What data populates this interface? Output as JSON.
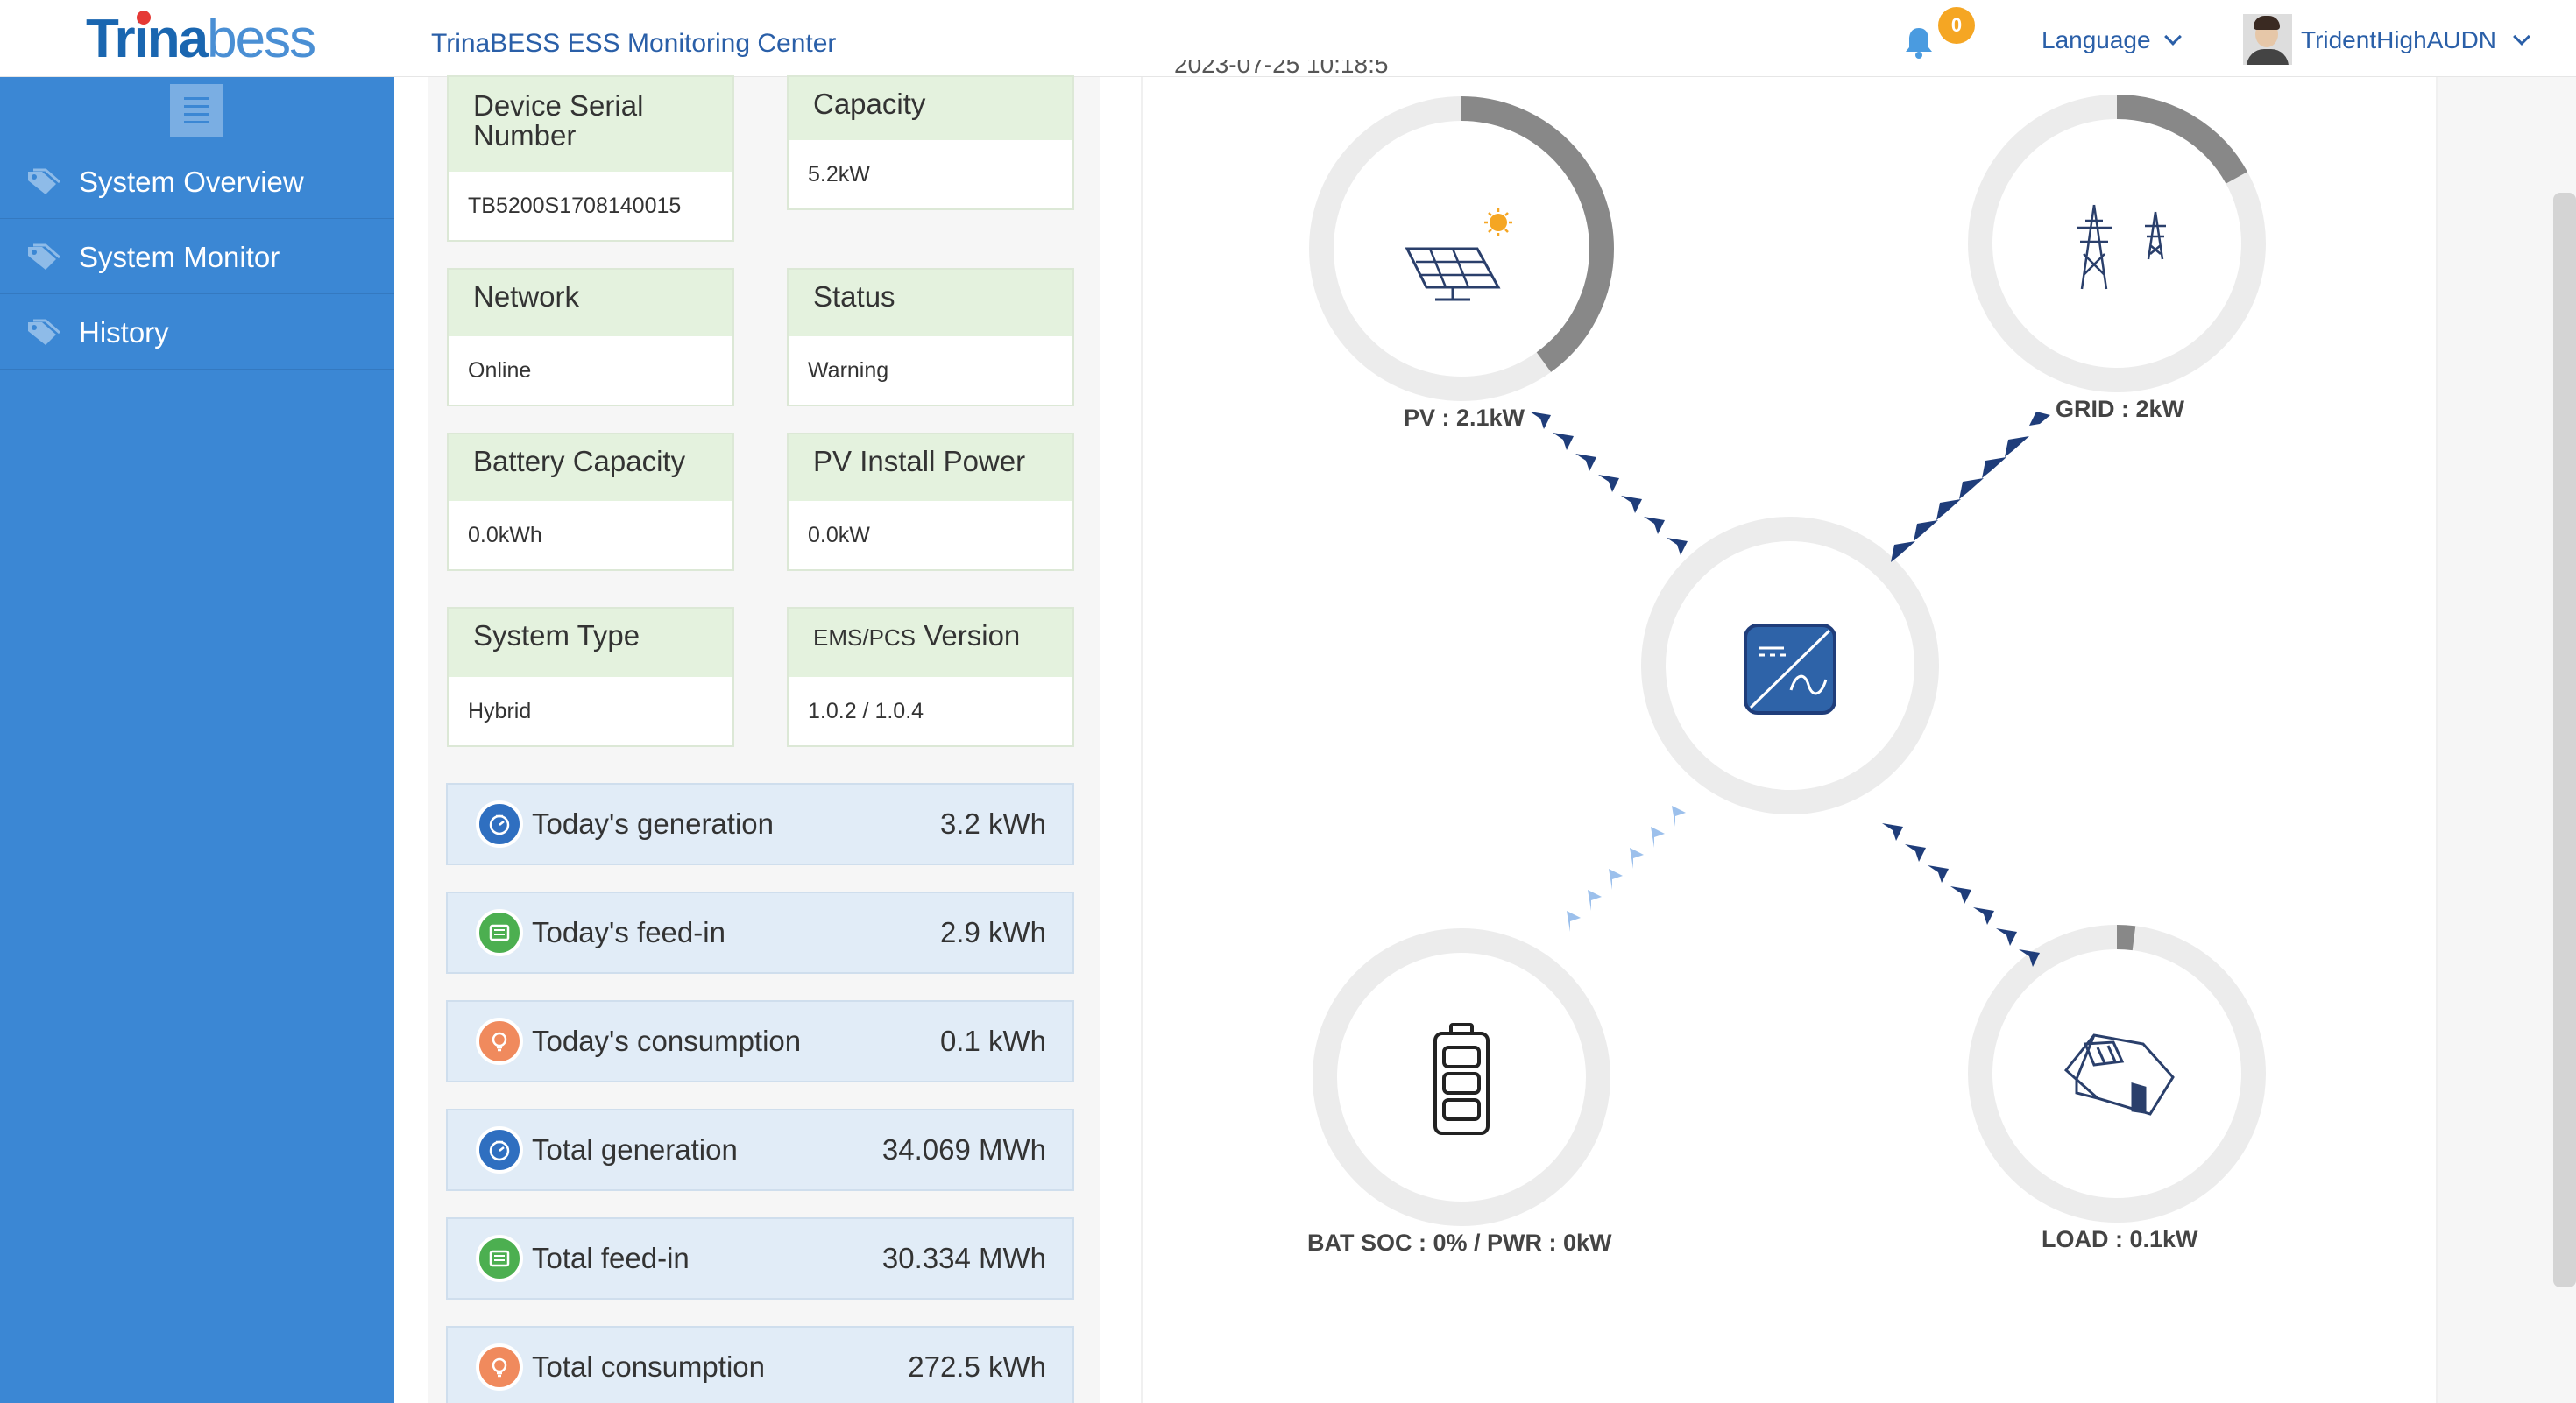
{
  "header": {
    "logo_bold": "Trina",
    "logo_light": "bess",
    "app_title": "TrinaBESS ESS Monitoring Center",
    "notification_count": "0",
    "language_label": "Language",
    "username": "TridentHighAUDN",
    "colors": {
      "brand": "#1a66b0",
      "badge": "#f5a623"
    }
  },
  "sidebar": {
    "color": "#3b87d4",
    "items": [
      {
        "label": "System Overview",
        "icon": "tag-icon"
      },
      {
        "label": "System Monitor",
        "icon": "tag-icon"
      },
      {
        "label": "History",
        "icon": "tag-icon"
      }
    ]
  },
  "info": {
    "cards": [
      {
        "title": "Device Serial Number",
        "value": "TB5200S1708140015"
      },
      {
        "title": "Capacity",
        "value": "5.2kW"
      },
      {
        "title": "Network",
        "value": "Online"
      },
      {
        "title": "Status",
        "value": "Warning"
      },
      {
        "title": "Battery Capacity",
        "value": "0.0kWh"
      },
      {
        "title": "PV Install Power",
        "value": "0.0kW"
      },
      {
        "title": "System Type",
        "value": "Hybrid"
      },
      {
        "title_prefix": "EMS/PCS",
        "title": " Version",
        "value": "1.0.2 / 1.0.4"
      }
    ],
    "stats": [
      {
        "label": "Today's generation",
        "value": "3.2 kWh",
        "icon": "generation-icon"
      },
      {
        "label": "Today's feed-in",
        "value": "2.9 kWh",
        "icon": "feed-in-icon"
      },
      {
        "label": "Today's consumption",
        "value": "0.1 kWh",
        "icon": "consumption-icon"
      },
      {
        "label": "Total generation",
        "value": "34.069 MWh",
        "icon": "generation-icon"
      },
      {
        "label": "Total feed-in",
        "value": "30.334 MWh",
        "icon": "feed-in-icon"
      },
      {
        "label": "Total consumption",
        "value": "272.5 kWh",
        "icon": "consumption-icon"
      }
    ]
  },
  "diagram": {
    "timestamp": "2023-07-25 10:18:5",
    "pv_label": "PV : 2.1kW",
    "grid_label": "GRID : 2kW",
    "battery_label": "BAT SOC : 0% / PWR : 0kW",
    "load_label": "LOAD : 0.1kW",
    "pv_ring_fraction": 0.4,
    "grid_ring_fraction": 0.17,
    "load_ring_fraction": 0.02,
    "battery_ring_fraction": 0,
    "colors": {
      "ring_bg": "#ececec",
      "ring_fill": "#888888",
      "arrow_dark": "#1f3d7a",
      "arrow_light": "#9cc0ec"
    }
  }
}
